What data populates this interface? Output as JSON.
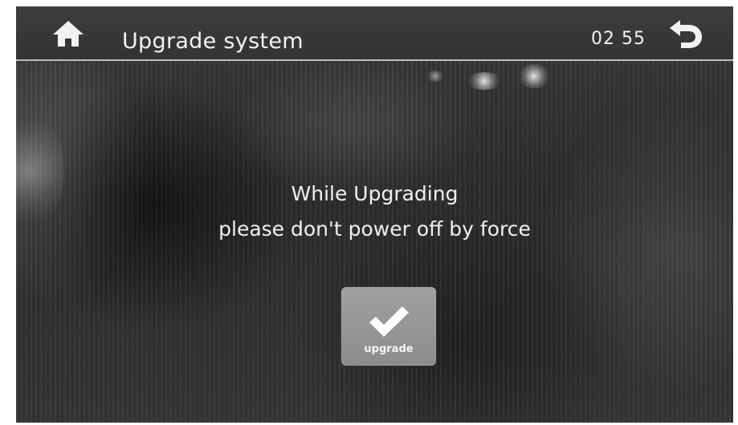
{
  "header": {
    "title": "Upgrade system",
    "clock": "02 55",
    "home_icon": "home-icon",
    "back_icon": "back-arrow-icon"
  },
  "message": {
    "line1": "While Upgrading",
    "line2": "please don't power off by force"
  },
  "upgrade_button": {
    "label": "upgrade",
    "icon": "checkmark-icon"
  },
  "colors": {
    "screen_bg": "#333333",
    "text": "#f2f2f2",
    "button_bg": "#999999",
    "header_divider": "#bdbdbd"
  }
}
